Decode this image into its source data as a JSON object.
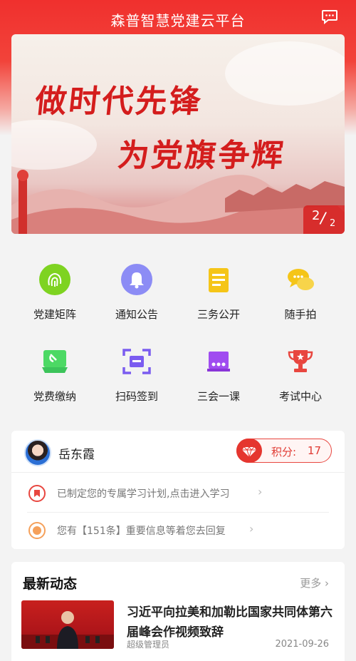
{
  "header": {
    "title": "森普智慧党建云平台",
    "message_icon": "chat-icon"
  },
  "banner": {
    "line1": "做时代先锋",
    "line2": "为党旗争辉",
    "pager_current": "2",
    "pager_total": "2"
  },
  "grid": [
    {
      "label": "党建矩阵",
      "icon": "fingerprint-icon",
      "color": "#7ed321"
    },
    {
      "label": "通知公告",
      "icon": "bell-icon",
      "color": "#8c8cf5"
    },
    {
      "label": "三务公开",
      "icon": "document-icon",
      "color": "#f5c518"
    },
    {
      "label": "随手拍",
      "icon": "chat-bubbles-icon",
      "color": "#f5c518"
    },
    {
      "label": "党费缴纳",
      "icon": "party-flag-icon",
      "color": "#4cd964"
    },
    {
      "label": "扫码签到",
      "icon": "scan-icon",
      "color": "#7b5cf0"
    },
    {
      "label": "三会一课",
      "icon": "meeting-icon",
      "color": "#a04cf0"
    },
    {
      "label": "考试中心",
      "icon": "trophy-icon",
      "color": "#e8463f"
    }
  ],
  "user": {
    "name": "岳东霞",
    "points_label": "积分:",
    "points_value": "17"
  },
  "notices": [
    {
      "text": "已制定您的专属学习计划,点击进入学习",
      "icon": "book-icon",
      "color": "#e8463f"
    },
    {
      "text": "您有【151条】重要信息等着您去回复",
      "icon": "dot-icon",
      "color": "#f5a05a"
    }
  ],
  "news": {
    "section_title": "最新动态",
    "more_label": "更多",
    "items": [
      {
        "title": "习近平向拉美和加勒比国家共同体第六届峰会作视频致辞",
        "author": "超级管理员",
        "date": "2021-09-26"
      }
    ]
  }
}
